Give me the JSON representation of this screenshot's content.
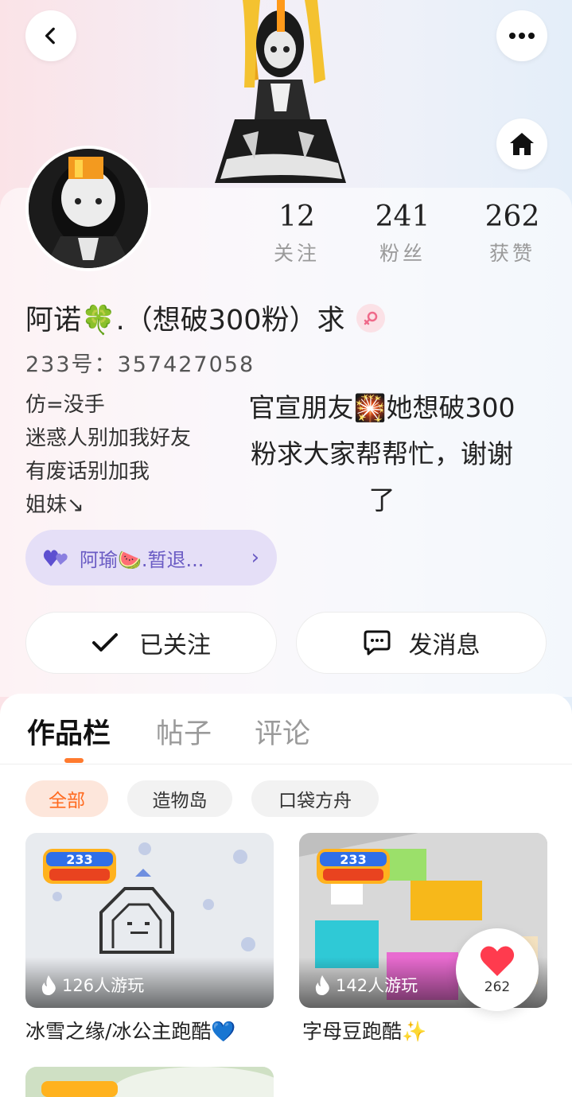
{
  "header": {
    "back_icon": "chevron-left-icon",
    "more_icon": "more-horizontal-icon",
    "home_icon": "home-icon"
  },
  "profile": {
    "stats": [
      {
        "value": "12",
        "label": "关注"
      },
      {
        "value": "241",
        "label": "粉丝"
      },
      {
        "value": "262",
        "label": "获赞"
      }
    ],
    "nickname": "阿诺🍀.（想破300粉）求",
    "gender": "female",
    "uid": "233号：357427058",
    "bio_lines": [
      "仿=没手",
      "迷惑人别加我好友",
      "有废话别加我",
      "姐妹↘"
    ],
    "note": "官宣朋友🎇她想破300粉求大家帮帮忙，谢谢了",
    "friend_pill": "阿瑜🍉.暂退...",
    "followed_label": "已关注",
    "message_label": "发消息"
  },
  "tabs": [
    {
      "label": "作品栏",
      "active": true
    },
    {
      "label": "帖子",
      "active": false
    },
    {
      "label": "评论",
      "active": false
    }
  ],
  "filters": [
    {
      "label": "全部",
      "active": true
    },
    {
      "label": "造物岛",
      "active": false
    },
    {
      "label": "口袋方舟",
      "active": false
    }
  ],
  "works": [
    {
      "badge": "233造物岛",
      "plays": "126人游玩",
      "title": "冰雪之缘/冰公主跑酷💙"
    },
    {
      "badge": "233造物岛",
      "plays": "142人游玩",
      "title": "字母豆跑酷✨"
    }
  ],
  "like_float": {
    "count": "262"
  },
  "colors": {
    "accent": "#ff6a1f",
    "pill_bg": "#e5dff7",
    "pill_text": "#6a5bc4"
  }
}
